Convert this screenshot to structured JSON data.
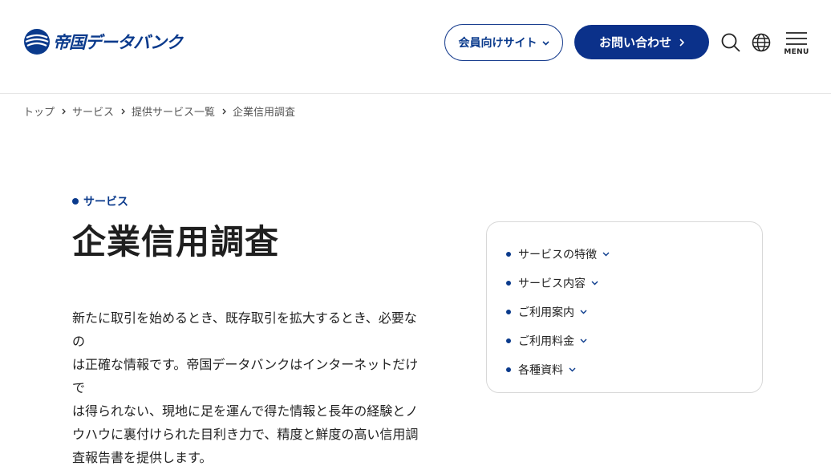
{
  "header": {
    "logo_text": "帝国データバンク",
    "member_site_label": "会員向けサイト",
    "contact_label": "お問い合わせ",
    "menu_label": "MENU",
    "icons": {
      "search": "search-icon",
      "language": "globe-icon",
      "menu": "hamburger-icon"
    }
  },
  "breadcrumb": {
    "items": [
      "トップ",
      "サービス",
      "提供サービス一覧",
      "企業信用調査"
    ]
  },
  "main": {
    "eyebrow": "サービス",
    "title": "企業信用調査",
    "intro_lines": [
      "新たに取引を始めるとき、既存取引を拡大するとき、必要なの",
      "は正確な情報です。帝国データバンクはインターネットだけで",
      "は得られない、現地に足を運んで得た情報と長年の経験とノ",
      "ウハウに裏付けられた目利き力で、精度と鮮度の高い信用調",
      "査報告書を提供します。"
    ]
  },
  "toc": {
    "items": [
      "サービスの特徴",
      "サービス内容",
      "ご利用案内",
      "ご利用料金",
      "各種資料"
    ]
  },
  "colors": {
    "brand": "#0b318a",
    "text": "#222222",
    "border": "#d8d8d8"
  }
}
